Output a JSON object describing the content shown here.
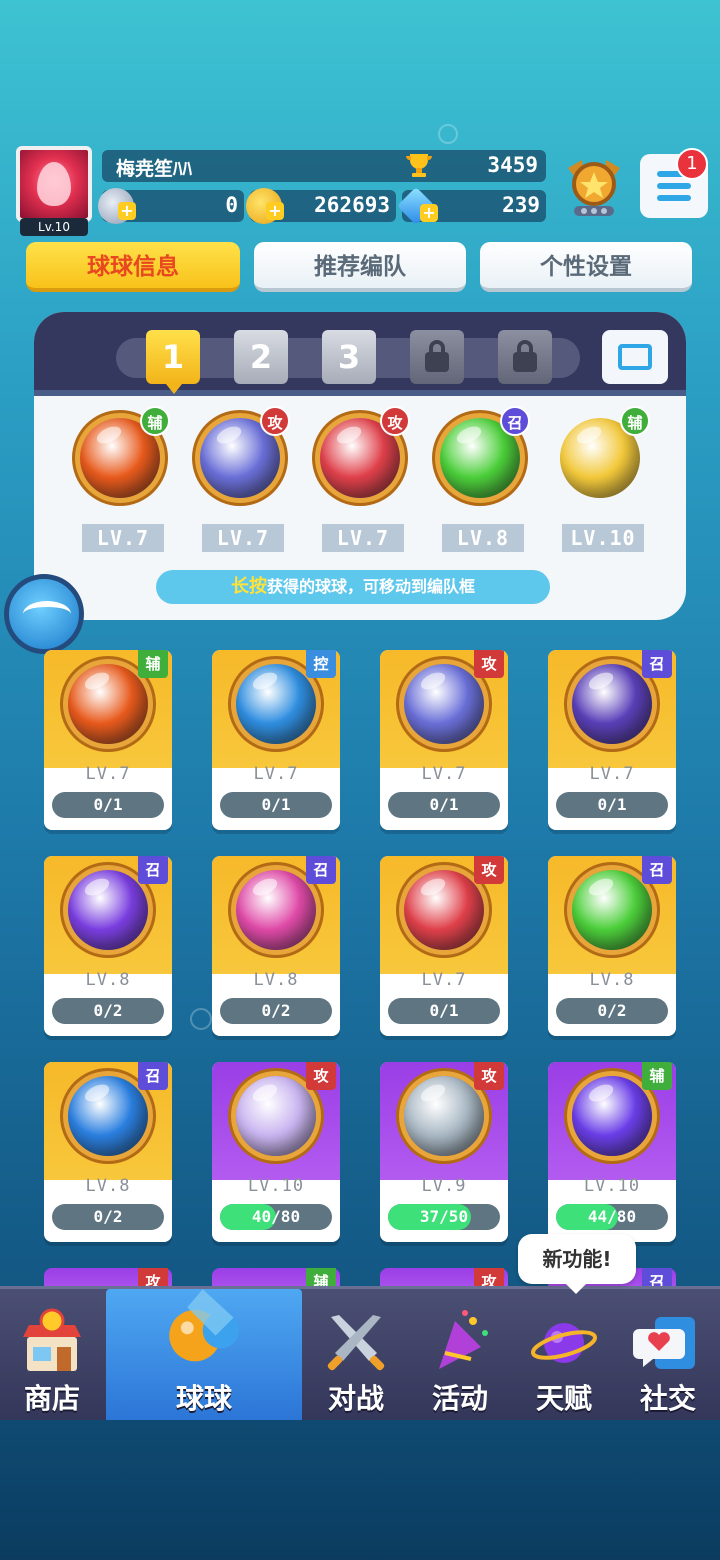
{
  "player": {
    "name": "梅尭笙ﾊﾊ",
    "level": "Lv.10",
    "trophies": "3459",
    "silver": "0",
    "gold": "262693",
    "gems": "239",
    "notifications": "1"
  },
  "tabs": [
    {
      "label": "球球信息",
      "active": true
    },
    {
      "label": "推荐编队",
      "active": false
    },
    {
      "label": "个性设置",
      "active": false
    }
  ],
  "team_slots": [
    "1",
    "2",
    "3"
  ],
  "team": [
    {
      "role": "辅",
      "level": "LV.7",
      "color": "#e85a1c"
    },
    {
      "role": "攻",
      "level": "LV.7",
      "color": "#6a6fd8"
    },
    {
      "role": "攻",
      "level": "LV.7",
      "color": "#e0404a"
    },
    {
      "role": "召",
      "level": "LV.8",
      "color": "#4ccf3a"
    },
    {
      "role": "辅",
      "level": "LV.10",
      "color": "#f2c83a"
    }
  ],
  "hint": {
    "key": "长按",
    "text": "获得的球球，可移动到编队框"
  },
  "cards": [
    {
      "role": "辅",
      "level": "LV.7",
      "progress": "0/1",
      "fill": 0,
      "bg": "gold",
      "color": "#e85a1c"
    },
    {
      "role": "控",
      "level": "LV.7",
      "progress": "0/1",
      "fill": 0,
      "bg": "gold",
      "color": "#2f8ee0"
    },
    {
      "role": "攻",
      "level": "LV.7",
      "progress": "0/1",
      "fill": 0,
      "bg": "gold",
      "color": "#6a6fd8"
    },
    {
      "role": "召",
      "level": "LV.7",
      "progress": "0/1",
      "fill": 0,
      "bg": "gold",
      "color": "#5a3fb8"
    },
    {
      "role": "召",
      "level": "LV.8",
      "progress": "0/2",
      "fill": 0,
      "bg": "gold",
      "color": "#7a3ee0"
    },
    {
      "role": "召",
      "level": "LV.8",
      "progress": "0/2",
      "fill": 0,
      "bg": "gold",
      "color": "#e04aa8"
    },
    {
      "role": "攻",
      "level": "LV.7",
      "progress": "0/1",
      "fill": 0,
      "bg": "gold",
      "color": "#e0404a"
    },
    {
      "role": "召",
      "level": "LV.8",
      "progress": "0/2",
      "fill": 0,
      "bg": "gold",
      "color": "#4ccf3a"
    },
    {
      "role": "召",
      "level": "LV.8",
      "progress": "0/2",
      "fill": 0,
      "bg": "gold",
      "color": "#2a7fe0"
    },
    {
      "role": "攻",
      "level": "LV.10",
      "progress": "40/80",
      "fill": 0.5,
      "bg": "purple",
      "color": "#c9b4f0"
    },
    {
      "role": "攻",
      "level": "LV.9",
      "progress": "37/50",
      "fill": 0.74,
      "bg": "purple",
      "color": "#a9b8c4"
    },
    {
      "role": "辅",
      "level": "LV.10",
      "progress": "44/80",
      "fill": 0.55,
      "bg": "purple",
      "color": "#6a3ee8"
    }
  ],
  "partial_roles": [
    "攻",
    "辅",
    "攻",
    "召"
  ],
  "nav": [
    {
      "label": "商店",
      "icon": "shop-icon",
      "active": false
    },
    {
      "label": "球球",
      "icon": "ball-icon",
      "active": true
    },
    {
      "label": "对战",
      "icon": "crossed-swords-icon",
      "active": false
    },
    {
      "label": "活动",
      "icon": "party-popper-icon",
      "active": false
    },
    {
      "label": "天赋",
      "icon": "planet-icon",
      "active": false
    },
    {
      "label": "社交",
      "icon": "chat-heart-icon",
      "active": false
    }
  ],
  "tooltip": "新功能!"
}
